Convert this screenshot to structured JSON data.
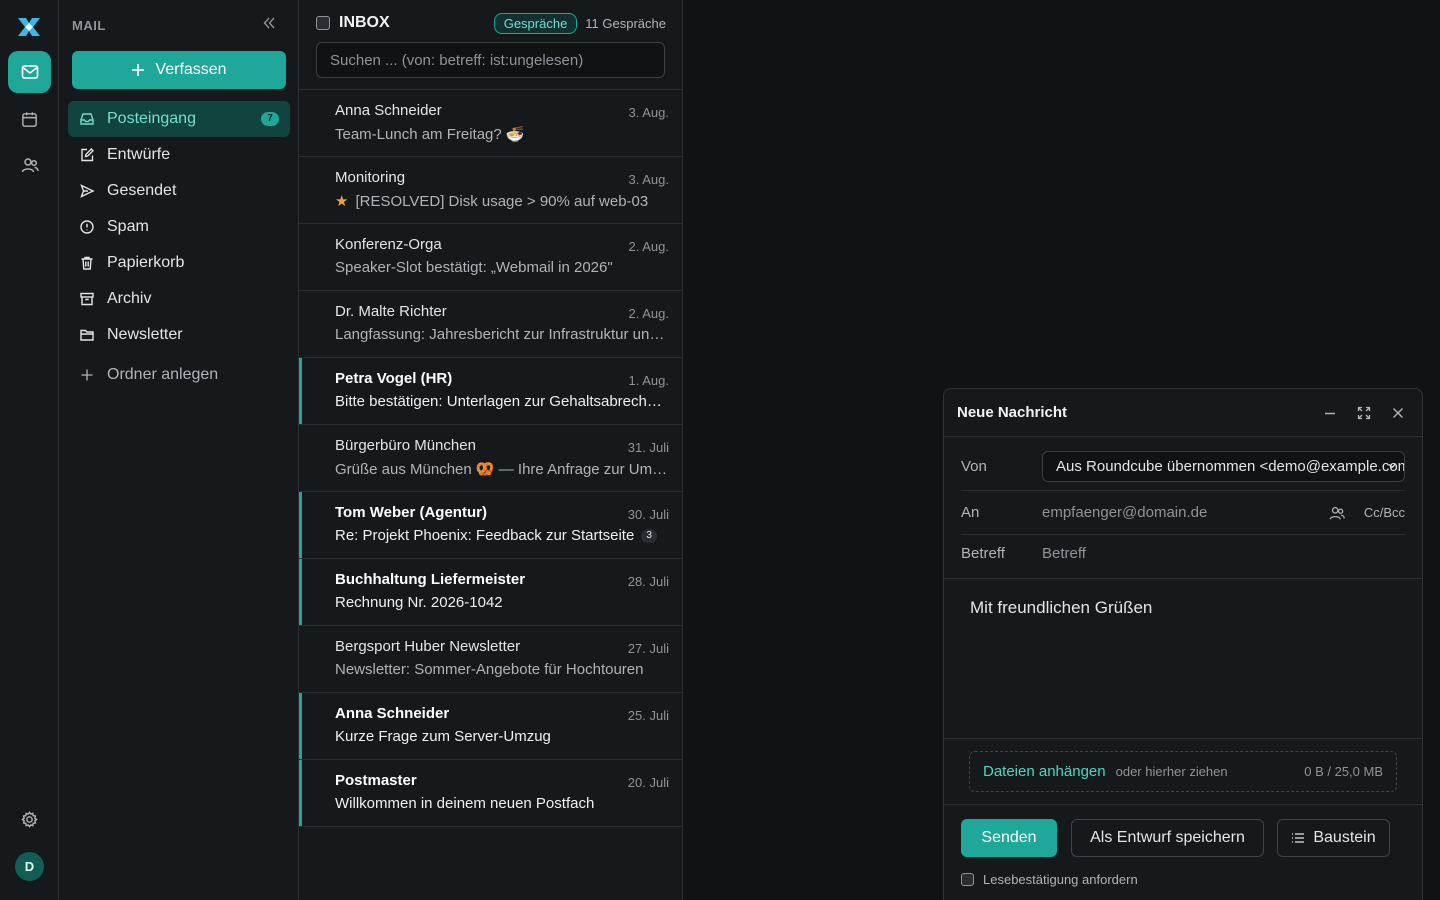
{
  "rail": {
    "avatar_initial": "D"
  },
  "folders": {
    "header": "MAIL",
    "compose_label": "Verfassen",
    "items": [
      {
        "label": "Posteingang",
        "icon": "inbox-icon",
        "count": "7",
        "active": true
      },
      {
        "label": "Entwürfe",
        "icon": "pencil-icon"
      },
      {
        "label": "Gesendet",
        "icon": "send-icon"
      },
      {
        "label": "Spam",
        "icon": "alert-icon"
      },
      {
        "label": "Papierkorb",
        "icon": "trash-icon"
      },
      {
        "label": "Archiv",
        "icon": "archive-icon"
      },
      {
        "label": "Newsletter",
        "icon": "folder-icon"
      }
    ],
    "new_folder_label": "Ordner anlegen"
  },
  "list": {
    "title": "INBOX",
    "conversations_pill": "Gespräche",
    "conversations_count": "11 Gespräche",
    "search_placeholder": "Suchen ... (von: betreff: ist:ungelesen)",
    "messages": [
      {
        "sender": "Anna Schneider",
        "date": "3. Aug.",
        "subject": "Team-Lunch am Freitag? 🍜",
        "unread": false
      },
      {
        "sender": "Monitoring",
        "date": "3. Aug.",
        "subject": "[RESOLVED] Disk usage > 90% auf web-03",
        "unread": false,
        "starred": true
      },
      {
        "sender": "Konferenz-Orga",
        "date": "2. Aug.",
        "subject": "Speaker-Slot bestätigt: „Webmail in 2026\"",
        "unread": false
      },
      {
        "sender": "Dr. Malte Richter",
        "date": "2. Aug.",
        "subject": "Langfassung: Jahresbericht zur Infrastruktur und Betriebskonzept",
        "unread": false
      },
      {
        "sender": "Petra Vogel (HR)",
        "date": "1. Aug.",
        "subject": "Bitte bestätigen: Unterlagen zur Gehaltsabrechnung",
        "unread": true
      },
      {
        "sender": "Bürgerbüro München",
        "date": "31. Juli",
        "subject": "Grüße aus München 🥨 — Ihre Anfrage zur Ummeldung",
        "unread": false
      },
      {
        "sender": "Tom Weber (Agentur)",
        "date": "30. Juli",
        "subject": "Re: Projekt Phoenix: Feedback zur Startseite",
        "unread": true,
        "thread": "3"
      },
      {
        "sender": "Buchhaltung Liefermeister",
        "date": "28. Juli",
        "subject": "Rechnung Nr. 2026-1042",
        "unread": true
      },
      {
        "sender": "Bergsport Huber Newsletter",
        "date": "27. Juli",
        "subject": "Newsletter: Sommer-Angebote für Hochtouren",
        "unread": false
      },
      {
        "sender": "Anna Schneider",
        "date": "25. Juli",
        "subject": "Kurze Frage zum Server-Umzug",
        "unread": true
      },
      {
        "sender": "Postmaster",
        "date": "20. Juli",
        "subject": "Willkommen in deinem neuen Postfach",
        "unread": true
      }
    ]
  },
  "compose": {
    "title": "Neue Nachricht",
    "from_label": "Von",
    "from_value": "Aus Roundcube übernommen <demo@example.com>",
    "to_label": "An",
    "to_placeholder": "empfaenger@domain.de",
    "ccbcc": "Cc/Bcc",
    "subject_label": "Betreff",
    "subject_placeholder": "Betreff",
    "body": "Mit freundlichen Grüßen",
    "attach_link": "Dateien anhängen",
    "attach_hint": "oder hierher ziehen",
    "attach_size": "0 B / 25,0 MB",
    "send_label": "Senden",
    "draft_label": "Als Entwurf speichern",
    "snippet_label": "Baustein",
    "receipt_label": "Lesebestätigung anfordern"
  },
  "colors": {
    "accent": "#1fa899",
    "background": "#101214",
    "panel": "#16191c"
  }
}
